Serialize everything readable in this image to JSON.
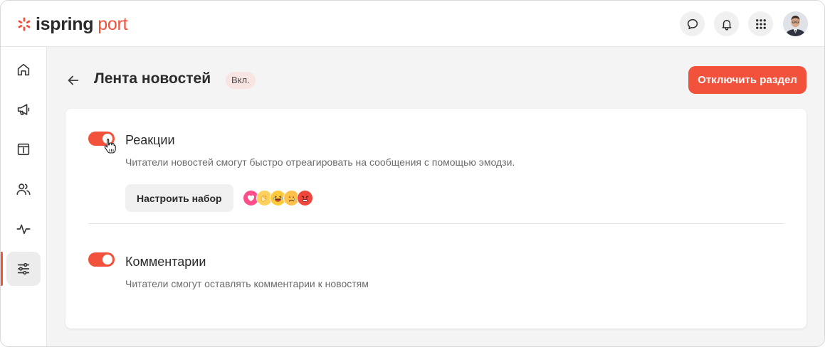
{
  "brand": {
    "name_part1": "ispring",
    "name_part2": "port",
    "accent": "#f2513b"
  },
  "header": {
    "icons": [
      "chat-icon",
      "bell-icon",
      "apps-grid-icon"
    ]
  },
  "sidebar": {
    "items": [
      {
        "icon": "home-icon",
        "active": false
      },
      {
        "icon": "megaphone-icon",
        "active": false
      },
      {
        "icon": "info-board-icon",
        "active": false
      },
      {
        "icon": "users-icon",
        "active": false
      },
      {
        "icon": "activity-icon",
        "active": false
      },
      {
        "icon": "sliders-icon",
        "active": true
      }
    ]
  },
  "page": {
    "title": "Лента новостей",
    "status_badge": "Вкл.",
    "disable_button": "Отключить раздел"
  },
  "settings": {
    "reactions": {
      "title": "Реакции",
      "enabled": true,
      "description": "Читатели новостей смогут быстро отреагировать на сообщения с помощью эмодзи.",
      "configure_button": "Настроить набор",
      "emojis": [
        "heart",
        "clapping-hands",
        "laughing",
        "sad",
        "angry"
      ]
    },
    "comments": {
      "title": "Комментарии",
      "enabled": true,
      "description": "Читатели смогут оставлять комментарии к новостям"
    }
  }
}
